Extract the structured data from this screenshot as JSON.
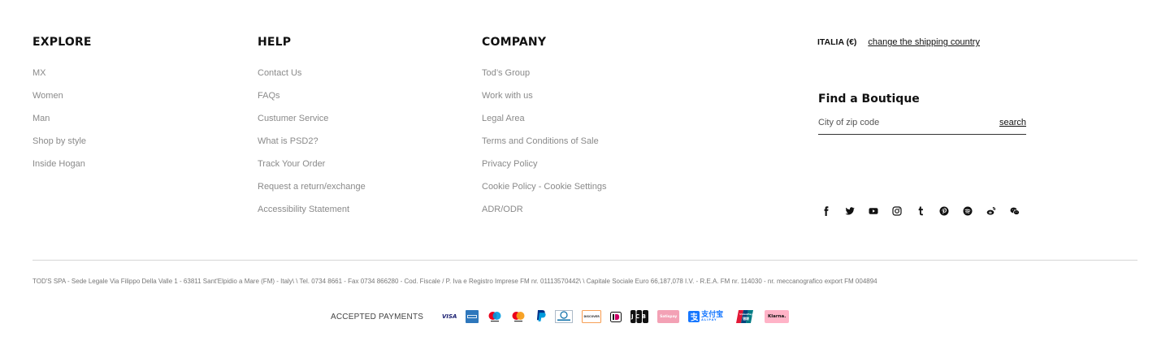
{
  "explore": {
    "title": "EXPLORE",
    "items": [
      "MX",
      "Women",
      "Man",
      "Shop by style",
      "Inside Hogan"
    ]
  },
  "help": {
    "title": "HELP",
    "items": [
      "Contact Us",
      "FAQs",
      "Custumer Service",
      "What is PSD2?",
      "Track Your Order",
      "Request a return/exchange",
      "Accessibility Statement"
    ]
  },
  "company": {
    "title": "COMPANY",
    "items": [
      "Tod’s Group",
      "Work with us",
      "Legal Area",
      "Terms and Conditions of Sale",
      "Privacy Policy",
      "Cookie Policy - Cookie Settings",
      "ADR/ODR"
    ]
  },
  "shipping": {
    "country": "ITALIA (€)",
    "change_label": "change the shipping country"
  },
  "boutique": {
    "title": "Find a Boutique",
    "placeholder": "City of zip code",
    "search_label": "search"
  },
  "social_icons": [
    "facebook-icon",
    "twitter-icon",
    "youtube-icon",
    "instagram-icon",
    "tumblr-icon",
    "pinterest-icon",
    "spotify-icon",
    "weibo-icon",
    "wechat-icon"
  ],
  "legal_text": "TOD'S SPA - Sede Legale Via Filippo Della Valle 1 - 63811 Sant'Elpidio a Mare (FM) - Italy\\ \\ Tel. 0734 8661 - Fax 0734 866280 - Cod. Fiscale / P. Iva e Registro Imprese FM nr. 01113570442\\ \\ Capitale Sociale Euro 66,187,078 I.V. - R.E.A. FM nr. 114030 - nr. meccanografico export FM 004894",
  "payments": {
    "label": "ACCEPTED PAYMENTS",
    "visa": "VISA",
    "discover": "DISCOVER",
    "satispay": "Satispay",
    "alipay": "支付宝",
    "alipay_sub": "ALIPAY",
    "unionpay": "UnionPay",
    "unionpay_sub": "银联",
    "klarna": "Klarna.",
    "jcb": "JCB"
  },
  "colors": {
    "text_dark": "#111111",
    "text_gray": "#8a8a8a",
    "divider": "#d6d6d6",
    "visa_blue": "#1a1f71",
    "mastercard_red": "#eb001b",
    "mastercard_yellow": "#f79e1b",
    "paypal_dark": "#003087",
    "paypal_light": "#009cde",
    "amex_blue": "#2e77bc",
    "klarna_pink": "#ffb3c7",
    "satispay_pink": "#f3a1b5",
    "alipay_blue": "#1677ff",
    "discover_orange": "#f58220"
  }
}
